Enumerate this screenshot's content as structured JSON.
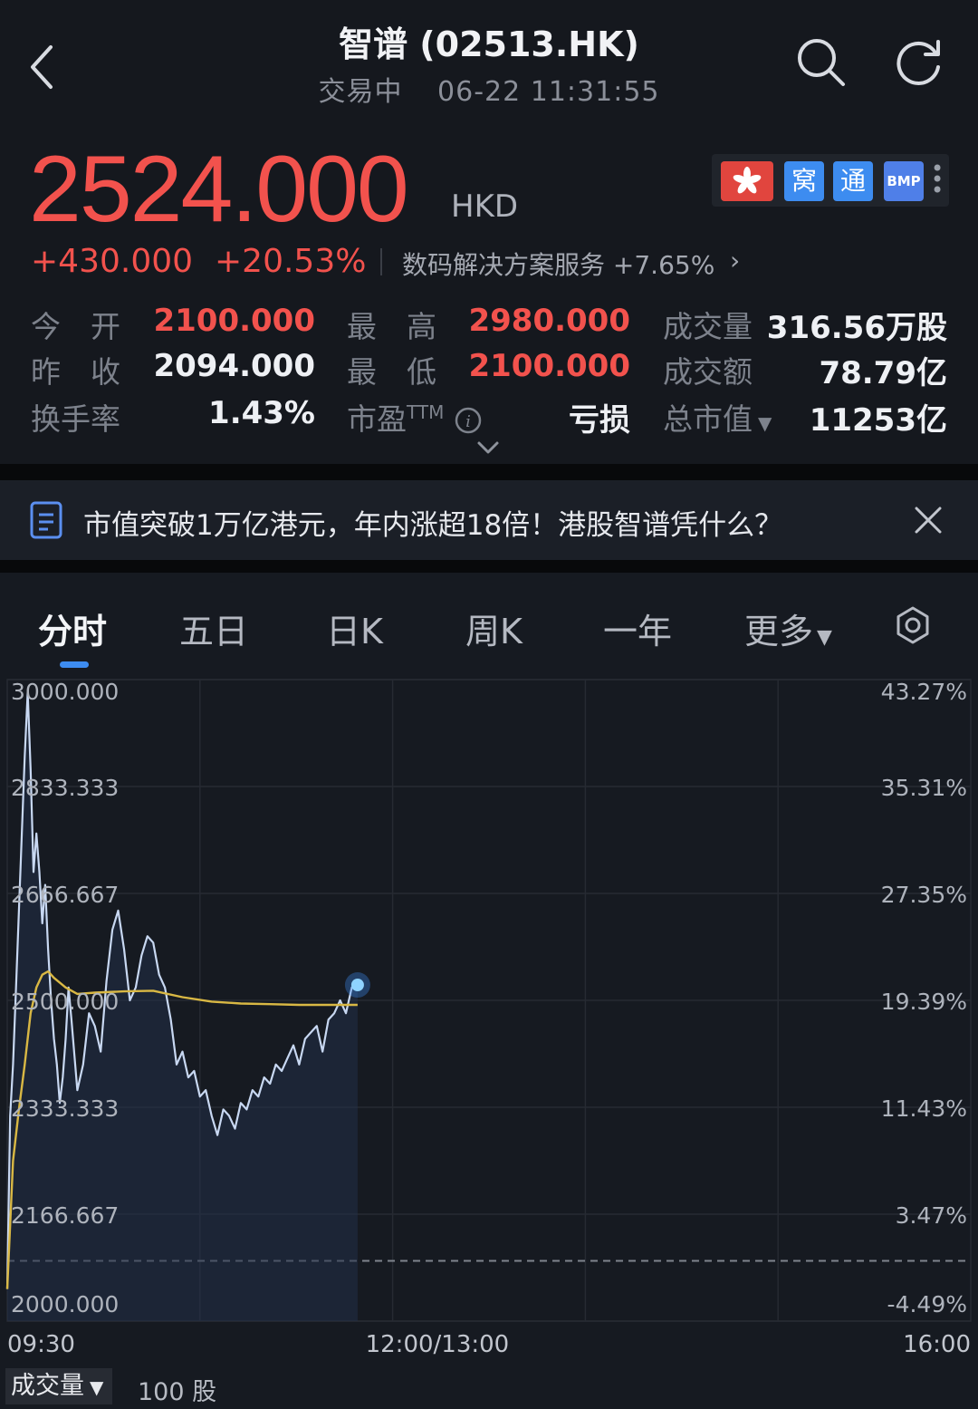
{
  "header": {
    "title": "智谱 (02513.HK)",
    "status": "交易中",
    "datetime": "06-22 11:31:55"
  },
  "quote": {
    "price": "2524.000",
    "currency": "HKD",
    "change_abs": "+430.000",
    "change_pct": "+20.53%",
    "sector": "数码解决方案服务 +7.65%",
    "badges": {
      "wo": "窝",
      "tong": "通",
      "bmp": "BMP"
    },
    "stats": [
      {
        "label": "今　开",
        "value": "2100.000",
        "color": "#f2524d"
      },
      {
        "label": "最　高",
        "value": "2980.000",
        "color": "#f2524d"
      },
      {
        "label": "成交量",
        "value": "316.56万股",
        "color": "#eef0f4"
      },
      {
        "label": "昨　收",
        "value": "2094.000",
        "color": "#eef0f4"
      },
      {
        "label": "最　低",
        "value": "2100.000",
        "color": "#f2524d"
      },
      {
        "label": "成交额",
        "value": "78.79亿",
        "color": "#eef0f4"
      },
      {
        "label": "换手率",
        "value": "1.43%",
        "color": "#eef0f4"
      },
      {
        "label": "市盈",
        "label_sup": "TTM",
        "value": "亏损",
        "color": "#eef0f4"
      },
      {
        "label": "总市值",
        "value": "11253亿",
        "color": "#eef0f4"
      }
    ]
  },
  "news": {
    "text": "市值突破1万亿港元，年内涨超18倍！港股智谱凭什么？"
  },
  "tabs": [
    {
      "label": "分时",
      "active": true
    },
    {
      "label": "五日"
    },
    {
      "label": "日K"
    },
    {
      "label": "周K"
    },
    {
      "label": "一年"
    },
    {
      "label": "更多"
    }
  ],
  "volume": {
    "selector": "成交量",
    "value": "100 股"
  },
  "chart_data": {
    "type": "line",
    "title": "",
    "xlabel": "",
    "ylabel": "",
    "x_ticks": [
      "09:30",
      "12:00/13:00",
      "16:00"
    ],
    "ylim": [
      2000,
      3000
    ],
    "y_ticks": [
      "3000.000",
      "2833.333",
      "2666.667",
      "2500.000",
      "2333.333",
      "2166.667",
      "2000.000"
    ],
    "y2_ticks": [
      "43.27%",
      "35.31%",
      "27.35%",
      "19.39%",
      "11.43%",
      "3.47%",
      "-4.49%"
    ],
    "reference_close": 2094,
    "x_sessions": 330,
    "x_range_minutes": [
      0,
      330
    ],
    "series": [
      {
        "color": "#c8d8f2",
        "x": [
          0,
          1,
          2,
          3,
          4,
          5,
          6,
          7,
          8,
          9,
          10,
          11,
          12,
          13,
          14,
          15,
          16,
          17,
          18,
          19,
          20,
          21,
          22,
          24,
          26,
          28,
          30,
          32,
          34,
          36,
          38,
          40,
          42,
          44,
          46,
          48,
          50,
          52,
          54,
          56,
          58,
          60,
          62,
          64,
          66,
          68,
          70,
          72,
          74,
          76,
          78,
          80,
          82,
          84,
          86,
          88,
          90,
          92,
          94,
          96,
          98,
          100,
          102,
          104,
          106,
          108,
          110,
          112,
          114,
          116,
          118,
          120
        ],
        "values": [
          2050,
          2320,
          2400,
          2520,
          2640,
          2760,
          2880,
          2980,
          2860,
          2700,
          2760,
          2700,
          2620,
          2680,
          2580,
          2500,
          2440,
          2400,
          2340,
          2380,
          2440,
          2520,
          2470,
          2360,
          2400,
          2480,
          2460,
          2420,
          2530,
          2610,
          2640,
          2580,
          2500,
          2520,
          2570,
          2600,
          2590,
          2540,
          2520,
          2470,
          2400,
          2420,
          2380,
          2390,
          2350,
          2360,
          2320,
          2290,
          2330,
          2320,
          2300,
          2340,
          2330,
          2360,
          2350,
          2380,
          2370,
          2400,
          2390,
          2410,
          2430,
          2400,
          2440,
          2450,
          2460,
          2420,
          2470,
          2480,
          2500,
          2480,
          2520,
          2524
        ]
      },
      {
        "color": "#d9b844",
        "x": [
          0,
          2,
          4,
          6,
          8,
          10,
          12,
          14,
          16,
          20,
          24,
          30,
          40,
          50,
          60,
          70,
          80,
          90,
          100,
          110,
          120
        ],
        "values": [
          2050,
          2250,
          2330,
          2400,
          2480,
          2520,
          2540,
          2545,
          2535,
          2520,
          2510,
          2512,
          2514,
          2515,
          2505,
          2498,
          2495,
          2494,
          2493,
          2493,
          2493
        ]
      }
    ]
  }
}
